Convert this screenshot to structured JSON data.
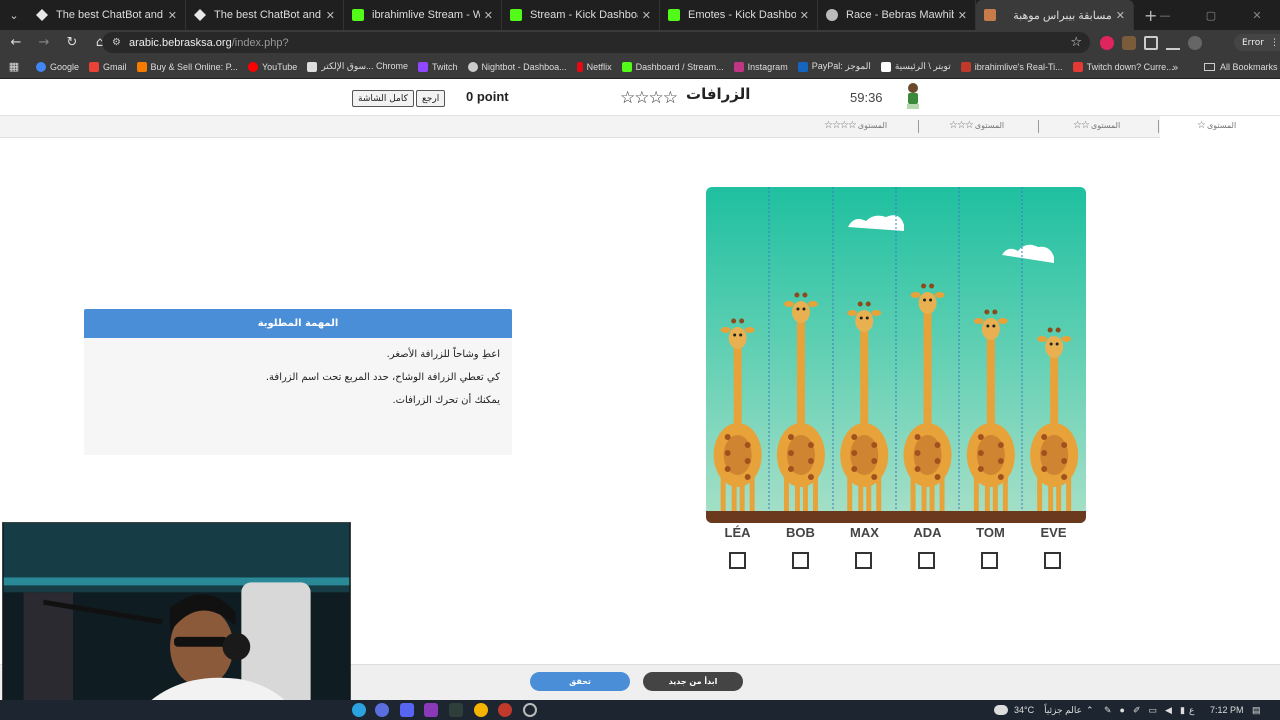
{
  "browser": {
    "tabs": [
      {
        "title": "The best ChatBot and Widgets",
        "favicon_color": "#e8e8e8"
      },
      {
        "title": "The best ChatBot and Widgets",
        "favicon_color": "#e8e8e8"
      },
      {
        "title": "ibrahimlive Stream - Watch Live",
        "favicon_color": "#53fc18"
      },
      {
        "title": "Stream - Kick Dashboard",
        "favicon_color": "#53fc18"
      },
      {
        "title": "Emotes - Kick Dashboard",
        "favicon_color": "#53fc18"
      },
      {
        "title": "Race - Bebras Mawhiba",
        "favicon_color": "#bbbbbb"
      },
      {
        "title": "مسابقة بيبراس موهبة",
        "favicon_color": "#c97b4a",
        "active": true
      }
    ],
    "url_host": "arabic.bebrasksa.org",
    "url_path": "/index.php?",
    "error_label": "Error",
    "bookmarks": [
      {
        "label": "Google",
        "color": "#4285f4"
      },
      {
        "label": "Gmail",
        "color": "#ea4335"
      },
      {
        "label": "Buy & Sell Online: P...",
        "color": "#f57c00"
      },
      {
        "label": "YouTube",
        "color": "#ff0000"
      },
      {
        "label": "سوق الإلكتر... Chrome",
        "color": "#dddddd"
      },
      {
        "label": "Twitch",
        "color": "#9146ff"
      },
      {
        "label": "Nightbot - Dashboa...",
        "color": "#cccccc"
      },
      {
        "label": "Netflix",
        "color": "#e50914"
      },
      {
        "label": "Dashboard / Stream...",
        "color": "#53fc18"
      },
      {
        "label": "Instagram",
        "color": "#c13584"
      },
      {
        "label": "PayPal: الموجز",
        "color": "#1565c0"
      },
      {
        "label": "تويتر \\ الرئيسية",
        "color": "#ffffff"
      },
      {
        "label": "ibrahimlive's Real-Ti...",
        "color": "#c0392b"
      },
      {
        "label": "Twitch down? Curre...",
        "color": "#e53935"
      }
    ],
    "all_bookmarks": "All Bookmarks"
  },
  "game": {
    "fullscreen_label": "كامل الشاشة",
    "back_label": "ارجع",
    "points": "0 point",
    "stars": "☆☆☆☆",
    "task_title": "الزرافات",
    "timer": "59:36",
    "levels": [
      {
        "label": "المستوى",
        "stars": "☆☆☆☆"
      },
      {
        "label": "المستوى",
        "stars": "☆☆☆"
      },
      {
        "label": "المستوى",
        "stars": "☆☆"
      },
      {
        "label": "المستوى",
        "stars": "☆"
      }
    ],
    "task_header": "المهمة المطلوبة",
    "task_lines": [
      "اعطِ وشاحاً للزرافة الأصغر.",
      "كي تعطي الزرافة الوشاح، حدد المربع تحت اسم الزرافة.",
      "يمكنك أن تحرك الزرافات."
    ],
    "giraffes": [
      {
        "name": "LÉA",
        "checked": false
      },
      {
        "name": "BOB",
        "checked": false
      },
      {
        "name": "MAX",
        "checked": false
      },
      {
        "name": "ADA",
        "checked": false
      },
      {
        "name": "TOM",
        "checked": false
      },
      {
        "name": "EVE",
        "checked": false
      }
    ],
    "check_label": "تحقق",
    "restart_label": "ابدأ من جديد"
  },
  "taskbar": {
    "weather": "34°C",
    "weather_text": "عالم جزئياً",
    "lang": "ع",
    "time": "7:12 PM"
  },
  "colors": {
    "accent_blue": "#4a8ed8",
    "sky_top": "#1ec0a0",
    "sky_bottom": "#a8e0c8",
    "restart_btn": "#444444"
  }
}
